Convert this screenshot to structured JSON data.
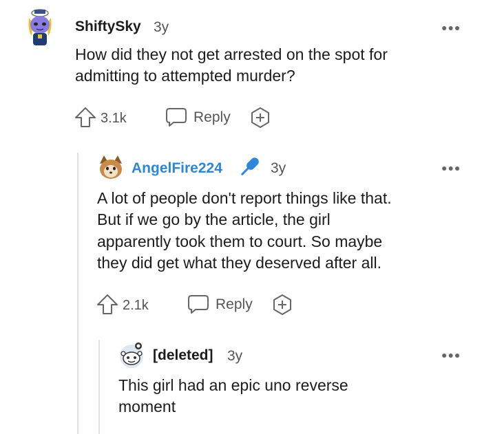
{
  "comments": [
    {
      "username": "ShiftySky",
      "age": "3y",
      "text_line1": "How did they not get arrested on the spot for",
      "text_line2": "admitting to attempted murder?",
      "upvotes": "3.1k",
      "reply_label": "Reply"
    },
    {
      "username": "AngelFire224",
      "age": "3y",
      "text_line1": "A lot of people don't report things like that.",
      "text_line2": "But if we go by the article, the girl",
      "text_line3": "apparently took them to court. So maybe",
      "text_line4": "they did get what they deserved after all.",
      "upvotes": "2.1k",
      "reply_label": "Reply"
    },
    {
      "username": "[deleted]",
      "age": "3y",
      "text_line1": "This girl had an epic uno reverse",
      "text_line2": "moment"
    }
  ],
  "colors": {
    "op_username": "#1c1c1c",
    "reply_username": "#2f86d6",
    "mic_icon": "#2f86d6",
    "muted": "#555555",
    "thread_line": "#e3e3e3"
  },
  "icons": [
    "avatar-shiftysky",
    "avatar-angelfire224",
    "avatar-deleted",
    "mic-icon",
    "upvote-icon",
    "reply-icon",
    "award-icon",
    "more-icon"
  ]
}
